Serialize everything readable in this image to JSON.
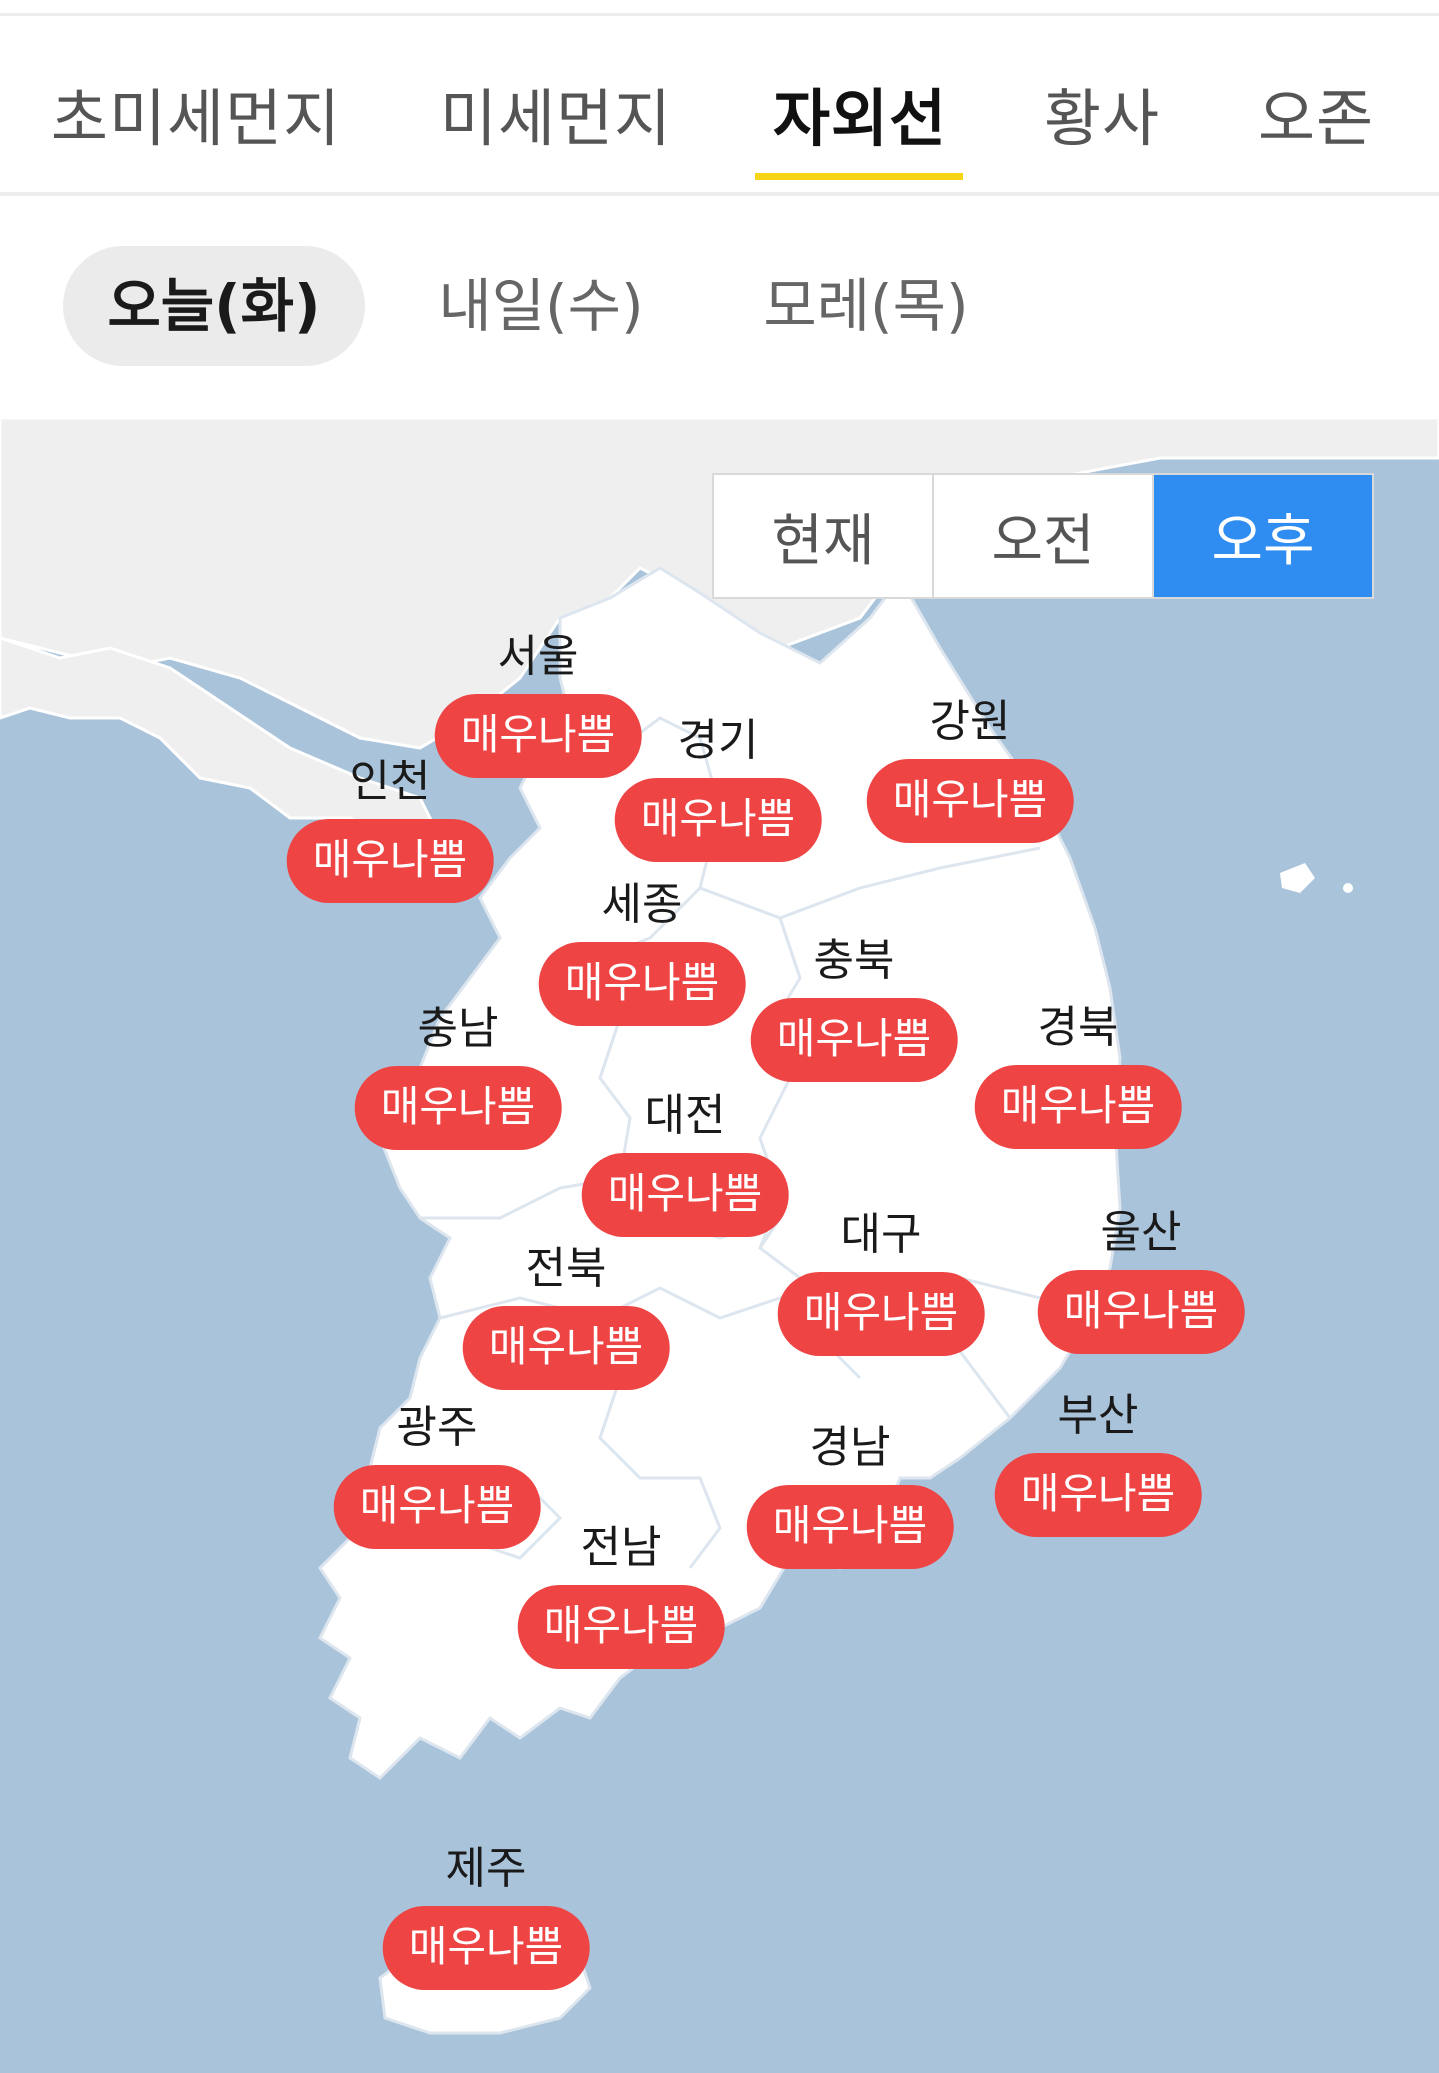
{
  "main_tabs": [
    {
      "label": "초미세먼지"
    },
    {
      "label": "미세먼지"
    },
    {
      "label": "자외선"
    },
    {
      "label": "황사"
    },
    {
      "label": "오존"
    }
  ],
  "active_main_tab": "자외선",
  "day_tabs": [
    {
      "label": "오늘(화)"
    },
    {
      "label": "내일(수)"
    },
    {
      "label": "모레(목)"
    }
  ],
  "active_day_tab": "오늘(화)",
  "time_toggle": [
    {
      "label": "현재"
    },
    {
      "label": "오전"
    },
    {
      "label": "오후"
    }
  ],
  "active_time": "오후",
  "regions": [
    {
      "name": "서울",
      "level": "매우나쁨"
    },
    {
      "name": "경기",
      "level": "매우나쁨"
    },
    {
      "name": "강원",
      "level": "매우나쁨"
    },
    {
      "name": "인천",
      "level": "매우나쁨"
    },
    {
      "name": "세종",
      "level": "매우나쁨"
    },
    {
      "name": "충북",
      "level": "매우나쁨"
    },
    {
      "name": "충남",
      "level": "매우나쁨"
    },
    {
      "name": "경북",
      "level": "매우나쁨"
    },
    {
      "name": "대전",
      "level": "매우나쁨"
    },
    {
      "name": "대구",
      "level": "매우나쁨"
    },
    {
      "name": "울산",
      "level": "매우나쁨"
    },
    {
      "name": "전북",
      "level": "매우나쁨"
    },
    {
      "name": "광주",
      "level": "매우나쁨"
    },
    {
      "name": "경남",
      "level": "매우나쁨"
    },
    {
      "name": "부산",
      "level": "매우나쁨"
    },
    {
      "name": "전남",
      "level": "매우나쁨"
    },
    {
      "name": "제주",
      "level": "매우나쁨"
    }
  ],
  "colors": {
    "active_tab_underline": "#f7d417",
    "level_very_bad": "#ee4444",
    "toggle_active": "#2f8cf0",
    "sea": "#a9c3da",
    "land": "#ffffff",
    "foreign_land": "#efefef"
  }
}
